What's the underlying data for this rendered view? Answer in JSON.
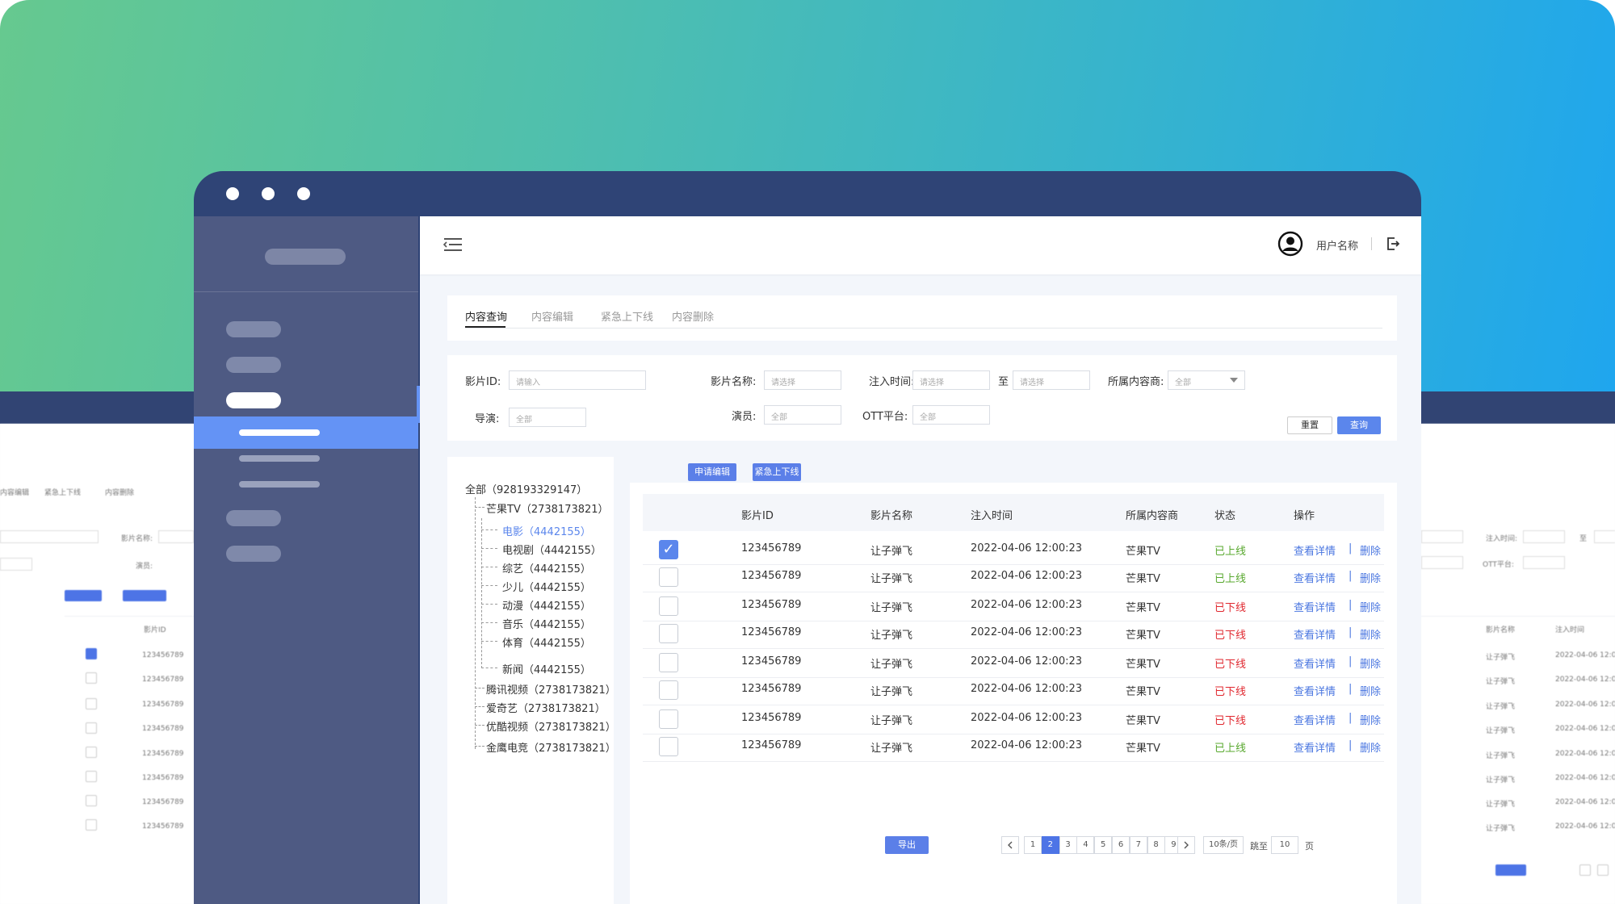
{
  "header": {
    "user_name": "用户名称"
  },
  "tabs": [
    {
      "label": "内容查询",
      "active": true
    },
    {
      "label": "内容编辑"
    },
    {
      "label": "紧急上下线"
    },
    {
      "label": "内容删除"
    }
  ],
  "filters": {
    "film_id": {
      "label": "影片ID:",
      "placeholder": "请输入"
    },
    "film_name": {
      "label": "影片名称:",
      "placeholder": "请选择"
    },
    "inject_time": {
      "label": "注入时间:",
      "start_placeholder": "请选择",
      "to": "至",
      "end_placeholder": "请选择"
    },
    "provider": {
      "label": "所属内容商:",
      "value": "全部"
    },
    "director": {
      "label": "导演:",
      "value": "全部"
    },
    "actor": {
      "label": "演员:",
      "value": "全部"
    },
    "ott": {
      "label": "OTT平台:",
      "value": "全部"
    },
    "reset_label": "重置",
    "query_label": "查询"
  },
  "tree": {
    "root": "全部（928193329147）",
    "nodes": [
      {
        "label": "芒果TV（2738173821）"
      },
      {
        "label": "电影（4442155）",
        "selected": true
      },
      {
        "label": "电视剧（4442155）"
      },
      {
        "label": "综艺（4442155）"
      },
      {
        "label": "少儿（4442155）"
      },
      {
        "label": "动漫（4442155）"
      },
      {
        "label": "音乐（4442155）"
      },
      {
        "label": "体育（4442155）"
      },
      {
        "label": "新闻（4442155）"
      },
      {
        "label": "腾讯视频（2738173821）"
      },
      {
        "label": "爱奇艺（2738173821）"
      },
      {
        "label": "优酷视频（2738173821）"
      },
      {
        "label": "金鹰电竞（2738173821）"
      }
    ]
  },
  "actions": {
    "apply_edit": "申请编辑",
    "emergency": "紧急上下线",
    "export": "导出"
  },
  "table": {
    "headers": [
      "影片ID",
      "影片名称",
      "注入时间",
      "所属内容商",
      "状态",
      "操作"
    ],
    "op_view": "查看详情",
    "op_sep": "|",
    "op_delete": "删除",
    "rows": [
      {
        "checked": true,
        "id": "123456789",
        "name": "让子弹飞",
        "time": "2022-04-06  12:00:23",
        "provider": "芒果TV",
        "status": "已上线",
        "online": true
      },
      {
        "checked": false,
        "id": "123456789",
        "name": "让子弹飞",
        "time": "2022-04-06  12:00:23",
        "provider": "芒果TV",
        "status": "已上线",
        "online": true
      },
      {
        "checked": false,
        "id": "123456789",
        "name": "让子弹飞",
        "time": "2022-04-06  12:00:23",
        "provider": "芒果TV",
        "status": "已下线",
        "online": false
      },
      {
        "checked": false,
        "id": "123456789",
        "name": "让子弹飞",
        "time": "2022-04-06  12:00:23",
        "provider": "芒果TV",
        "status": "已下线",
        "online": false
      },
      {
        "checked": false,
        "id": "123456789",
        "name": "让子弹飞",
        "time": "2022-04-06  12:00:23",
        "provider": "芒果TV",
        "status": "已下线",
        "online": false
      },
      {
        "checked": false,
        "id": "123456789",
        "name": "让子弹飞",
        "time": "2022-04-06  12:00:23",
        "provider": "芒果TV",
        "status": "已下线",
        "online": false
      },
      {
        "checked": false,
        "id": "123456789",
        "name": "让子弹飞",
        "time": "2022-04-06  12:00:23",
        "provider": "芒果TV",
        "status": "已下线",
        "online": false
      },
      {
        "checked": false,
        "id": "123456789",
        "name": "让子弹飞",
        "time": "2022-04-06  12:00:23",
        "provider": "芒果TV",
        "status": "已上线",
        "online": true
      }
    ]
  },
  "pagination": {
    "pages": [
      "1",
      "2",
      "3",
      "4",
      "5",
      "6",
      "7",
      "8",
      "9"
    ],
    "current": "2",
    "page_size": "10条/页",
    "jump_label": "跳至",
    "jump_value": "10",
    "page_unit": "页"
  },
  "colors": {
    "accent": "#5b86ec",
    "online": "#58a82e",
    "offline": "#e0282f",
    "window_frame": "#2f4476",
    "sidebar": "#4e5a83"
  }
}
